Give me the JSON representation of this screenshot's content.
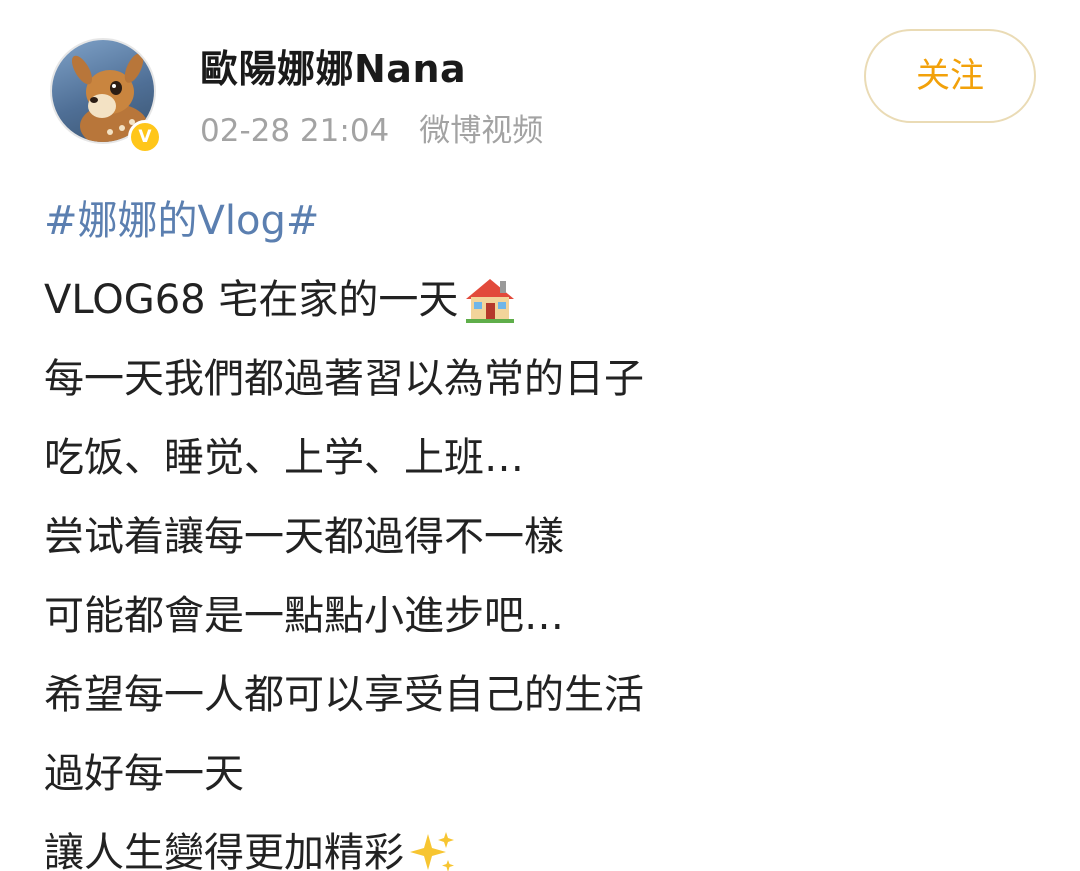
{
  "header": {
    "username": "歐陽娜娜Nana",
    "timestamp": "02-28 21:04",
    "source": "微博视频",
    "verified_badge": "V",
    "follow_label": "关注"
  },
  "avatar": {
    "icon": "fawn-avatar-icon"
  },
  "post": {
    "hashtag": "#娜娜的Vlog#",
    "lines": [
      "VLOG68 宅在家的一天",
      "每一天我們都過著習以為常的日子",
      "吃饭、睡觉、上学、上班…",
      "尝试着讓每一天都過得不一樣",
      "可能都會是一點點小進步吧…",
      "希望每一人都可以享受自己的生活",
      "過好每一天",
      "讓人生變得更加精彩"
    ],
    "emoji": {
      "line_1": "house-emoji-icon",
      "line_8": "sparkles-emoji-icon"
    }
  },
  "colors": {
    "hashtag": "#5b7fb0",
    "follow_text": "#f2a10a",
    "follow_border": "#eadbb5",
    "meta_text": "#a3a3a3",
    "verified": "#ffc61a"
  }
}
